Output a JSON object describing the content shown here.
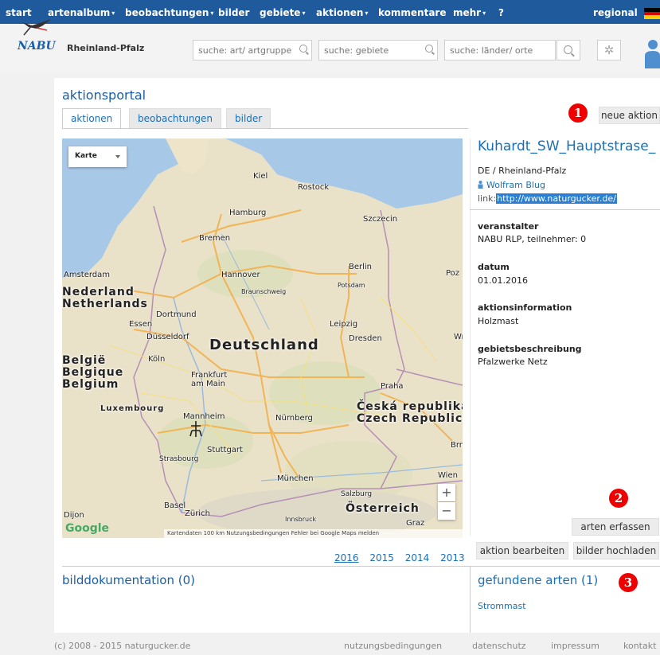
{
  "nav": {
    "items": [
      "start",
      "artenalbum",
      "beobachtungen",
      "bilder",
      "gebiete",
      "aktionen",
      "kommentare",
      "mehr",
      "?"
    ],
    "regional": "regional"
  },
  "header": {
    "logo_text": "NABU",
    "logo_subtitle": "Rheinland-Pfalz",
    "search_species_placeholder": "suche: art/ artgruppe",
    "search_areas_placeholder": "suche: gebiete",
    "search_places_placeholder": "suche: länder/ orte"
  },
  "page": {
    "title": "aktionsportal",
    "tabs": [
      "aktionen",
      "beobachtungen",
      "bilder"
    ],
    "new_action_label": "neue aktion",
    "markers": [
      "1",
      "2",
      "3"
    ]
  },
  "map": {
    "type_select": "Karte",
    "zoom_in": "+",
    "zoom_out": "−",
    "google": "Google",
    "footer_text": "Kartendaten  100 km  Nutzungsbedingungen   Fehler bei Google Maps melden",
    "countries": {
      "de": "Deutschland",
      "nl": "Nederland\nNetherlands",
      "be": "België\nBelgique\nBelgium",
      "lu": "Luxembourg",
      "cz": "Česká republika\nCzech Republic",
      "at": "Österreich"
    },
    "cities": {
      "kiel": "Kiel",
      "rostock": "Rostock",
      "hamburg": "Hamburg",
      "szczecin": "Szczecin",
      "bremen": "Bremen",
      "amsterdam": "Amsterdam",
      "hannover": "Hannover",
      "berlin": "Berlin",
      "potsdam": "Potsdam",
      "braunschweig": "Braunschweig",
      "dortmund": "Dortmund",
      "essen": "Essen",
      "dusseldorf": "Düsseldorf",
      "leipzig": "Leipzig",
      "dresden": "Dresden",
      "koln": "Köln",
      "frankfurt": "Frankfurt\nam Main",
      "praha": "Praha",
      "mannheim": "Mannheim",
      "nurnberg": "Nürnberg",
      "stuttgart": "Stuttgart",
      "strasbourg": "Strasbourg",
      "munchen": "München",
      "salzburg": "Salzburg",
      "wien": "Wien",
      "basel": "Basel",
      "zurich": "Zürich",
      "innsbruck": "Innsbruck",
      "dijon": "Dijon",
      "brno": "Brno",
      "graz": "Graz",
      "poz": "Poz",
      "wr": "Wr"
    }
  },
  "years": [
    "2016",
    "2015",
    "2014",
    "2013"
  ],
  "detail": {
    "title": "Kuhardt_SW_Hauptstrase_",
    "region": "DE / Rheinland-Pfalz",
    "author": "Wolfram Blug",
    "link_label": "link:",
    "link_url": "http://www.naturgucker.de/",
    "organizer_label": "veranstalter",
    "organizer_value": "NABU RLP, teilnehmer: 0",
    "date_label": "datum",
    "date_value": "01.01.2016",
    "info_label": "aktionsinformation",
    "info_value": "Holzmast",
    "area_label": "gebietsbeschreibung",
    "area_value": "Pfalzwerke Netz",
    "record_species_label": "arten erfassen",
    "edit_label": "aktion bearbeiten",
    "upload_label": "bilder hochladen"
  },
  "bottom": {
    "images_title": "bilddokumentation (0)",
    "species_title": "gefundene arten (1)",
    "species_item": "Strommast"
  },
  "footer": {
    "copyright": "(c) 2008 - 2015 naturgucker.de",
    "links": [
      "nutzungsbedingungen",
      "datenschutz",
      "impressum",
      "kontakt"
    ]
  },
  "colors": {
    "nav_bg": "#1e5a9c",
    "link": "#1a6fb5",
    "marker": "#e00000"
  }
}
